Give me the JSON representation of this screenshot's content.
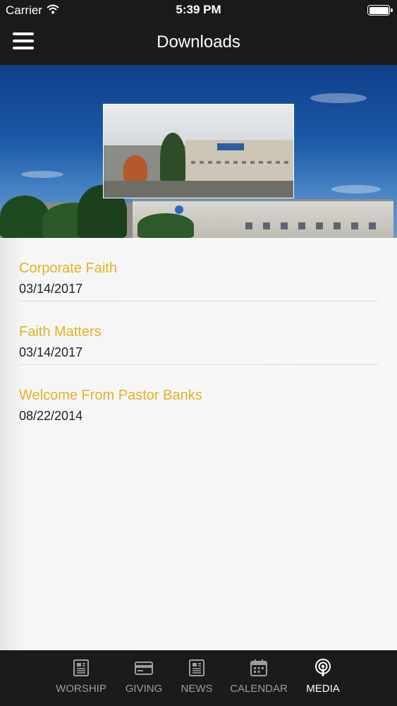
{
  "status_bar": {
    "carrier": "Carrier",
    "time": "5:39 PM"
  },
  "nav": {
    "title": "Downloads",
    "menu_icon": "hamburger-menu-icon"
  },
  "downloads": [
    {
      "title": "Corporate Faith",
      "date": "03/14/2017"
    },
    {
      "title": "Faith Matters",
      "date": "03/14/2017"
    },
    {
      "title": "Welcome From Pastor Banks",
      "date": "08/22/2014"
    }
  ],
  "tabs": [
    {
      "label": "WORSHIP",
      "icon": "document-icon",
      "active": false
    },
    {
      "label": "GIVING",
      "icon": "credit-card-icon",
      "active": false
    },
    {
      "label": "NEWS",
      "icon": "newspaper-icon",
      "active": false
    },
    {
      "label": "CALENDAR",
      "icon": "calendar-icon",
      "active": false
    },
    {
      "label": "MEDIA",
      "icon": "podcast-icon",
      "active": true
    }
  ],
  "colors": {
    "accent": "#e3b224",
    "bar_background": "#1b1b1b",
    "tab_inactive": "#9d9d9d",
    "tab_active": "#ffffff"
  }
}
